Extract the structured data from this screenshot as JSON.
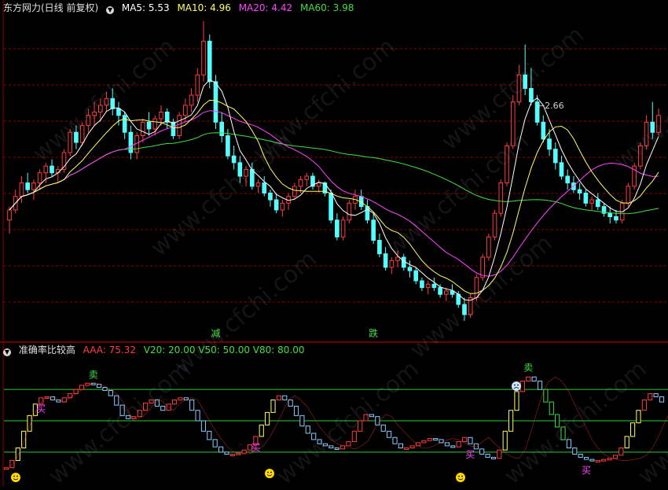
{
  "header": {
    "title": "东方网力(日线 前复权)",
    "ma": [
      {
        "label": "MA5: 5.53",
        "color": "#ffffff"
      },
      {
        "label": "MA10: 4.96",
        "color": "#ffff66"
      },
      {
        "label": "MA20: 4.42",
        "color": "#ff44ff"
      },
      {
        "label": "MA60: 3.98",
        "color": "#44dd44"
      }
    ]
  },
  "subheader": {
    "title": "准确率比较高",
    "aaa": "AAA: 75.32",
    "v": "V20: 20.00  V50: 50.00  V80: 80.00"
  },
  "watermark": "www.cfchi.com",
  "colors": {
    "up": "#ff3c3c",
    "down": "#54ffff",
    "ma5": "#ffffff",
    "ma10": "#ffff66",
    "ma20": "#ff44ff",
    "ma60": "#44dd44",
    "grid": "#8b0000",
    "level": "#2ecc40",
    "buy": "#ff44ff",
    "sell": "#44dd44"
  },
  "chart_data": [
    {
      "type": "candlestick",
      "title": "东方网力(日线 前复权)",
      "ylim": [
        2.4,
        7.2
      ],
      "annotations": [
        {
          "text": "2.66",
          "index": 86
        },
        {
          "text": "减",
          "index": 34
        },
        {
          "text": "跌",
          "index": 60
        }
      ],
      "ohlc": [
        [
          4.15,
          4.35,
          3.95,
          4.3
        ],
        [
          4.3,
          4.6,
          4.25,
          4.5
        ],
        [
          4.5,
          4.8,
          4.4,
          4.7
        ],
        [
          4.7,
          4.85,
          4.55,
          4.6
        ],
        [
          4.6,
          4.75,
          4.45,
          4.7
        ],
        [
          4.7,
          4.9,
          4.6,
          4.85
        ],
        [
          4.85,
          5.0,
          4.7,
          4.95
        ],
        [
          4.95,
          5.05,
          4.8,
          4.85
        ],
        [
          4.85,
          4.95,
          4.7,
          4.9
        ],
        [
          4.9,
          5.2,
          4.85,
          5.15
        ],
        [
          5.15,
          5.5,
          5.1,
          5.45
        ],
        [
          5.45,
          5.55,
          5.2,
          5.3
        ],
        [
          5.3,
          5.6,
          5.25,
          5.55
        ],
        [
          5.55,
          5.8,
          5.45,
          5.7
        ],
        [
          5.7,
          5.9,
          5.55,
          5.75
        ],
        [
          5.75,
          5.95,
          5.6,
          5.85
        ],
        [
          5.85,
          6.05,
          5.75,
          5.95
        ],
        [
          5.95,
          6.1,
          5.7,
          5.8
        ],
        [
          5.8,
          5.9,
          5.55,
          5.7
        ],
        [
          5.7,
          5.75,
          5.35,
          5.45
        ],
        [
          5.45,
          5.55,
          5.05,
          5.15
        ],
        [
          5.15,
          5.45,
          5.05,
          5.4
        ],
        [
          5.4,
          5.65,
          5.3,
          5.6
        ],
        [
          5.6,
          5.75,
          5.4,
          5.5
        ],
        [
          5.5,
          5.7,
          5.4,
          5.65
        ],
        [
          5.65,
          5.85,
          5.55,
          5.75
        ],
        [
          5.75,
          5.8,
          5.5,
          5.6
        ],
        [
          5.6,
          5.65,
          5.35,
          5.4
        ],
        [
          5.4,
          5.75,
          5.35,
          5.7
        ],
        [
          5.7,
          5.95,
          5.6,
          5.85
        ],
        [
          5.85,
          6.1,
          5.75,
          6.0
        ],
        [
          6.0,
          6.4,
          5.9,
          6.3
        ],
        [
          6.3,
          7.1,
          6.2,
          6.8
        ],
        [
          6.8,
          6.9,
          6.1,
          6.2
        ],
        [
          6.2,
          6.3,
          5.5,
          5.6
        ],
        [
          5.6,
          5.75,
          5.3,
          5.4
        ],
        [
          5.4,
          5.5,
          5.05,
          5.1
        ],
        [
          5.1,
          5.25,
          4.9,
          5.0
        ],
        [
          5.0,
          5.1,
          4.7,
          4.8
        ],
        [
          4.8,
          4.95,
          4.65,
          4.9
        ],
        [
          4.9,
          5.0,
          4.6,
          4.65
        ],
        [
          4.65,
          4.75,
          4.55,
          4.7
        ],
        [
          4.7,
          4.8,
          4.5,
          4.55
        ],
        [
          4.55,
          4.6,
          4.35,
          4.45
        ],
        [
          4.45,
          4.55,
          4.25,
          4.3
        ],
        [
          4.3,
          4.45,
          4.2,
          4.4
        ],
        [
          4.4,
          4.55,
          4.3,
          4.5
        ],
        [
          4.5,
          4.7,
          4.45,
          4.65
        ],
        [
          4.65,
          4.8,
          4.55,
          4.75
        ],
        [
          4.75,
          4.85,
          4.65,
          4.8
        ],
        [
          4.8,
          4.85,
          4.6,
          4.65
        ],
        [
          4.65,
          4.75,
          4.55,
          4.7
        ],
        [
          4.7,
          4.72,
          4.5,
          4.55
        ],
        [
          4.55,
          4.6,
          4.1,
          4.15
        ],
        [
          4.15,
          4.25,
          3.85,
          3.9
        ],
        [
          3.9,
          4.2,
          3.85,
          4.15
        ],
        [
          4.15,
          4.45,
          4.1,
          4.4
        ],
        [
          4.4,
          4.6,
          4.3,
          4.5
        ],
        [
          4.5,
          4.6,
          4.3,
          4.35
        ],
        [
          4.35,
          4.45,
          4.1,
          4.15
        ],
        [
          4.15,
          4.25,
          3.8,
          3.85
        ],
        [
          3.85,
          3.95,
          3.6,
          3.65
        ],
        [
          3.65,
          3.75,
          3.4,
          3.45
        ],
        [
          3.45,
          3.6,
          3.35,
          3.55
        ],
        [
          3.55,
          3.7,
          3.45,
          3.6
        ],
        [
          3.6,
          3.65,
          3.4,
          3.45
        ],
        [
          3.45,
          3.55,
          3.3,
          3.4
        ],
        [
          3.4,
          3.45,
          3.2,
          3.25
        ],
        [
          3.25,
          3.3,
          3.1,
          3.15
        ],
        [
          3.15,
          3.25,
          3.05,
          3.2
        ],
        [
          3.2,
          3.3,
          3.1,
          3.15
        ],
        [
          3.15,
          3.2,
          3.0,
          3.05
        ],
        [
          3.05,
          3.15,
          2.95,
          3.1
        ],
        [
          3.1,
          3.2,
          3.0,
          3.05
        ],
        [
          3.05,
          3.1,
          2.85,
          2.9
        ],
        [
          2.9,
          3.0,
          2.66,
          2.75
        ],
        [
          2.75,
          3.05,
          2.7,
          3.0
        ],
        [
          3.0,
          3.35,
          2.95,
          3.3
        ],
        [
          3.3,
          3.65,
          3.25,
          3.6
        ],
        [
          3.6,
          3.95,
          3.55,
          3.9
        ],
        [
          3.9,
          4.3,
          3.85,
          4.25
        ],
        [
          4.25,
          4.75,
          4.2,
          4.7
        ],
        [
          4.7,
          5.3,
          4.65,
          5.25
        ],
        [
          5.25,
          6.0,
          5.2,
          5.9
        ],
        [
          5.9,
          6.45,
          5.85,
          6.3
        ],
        [
          6.3,
          6.75,
          6.0,
          6.1
        ],
        [
          6.1,
          6.4,
          5.85,
          5.9
        ],
        [
          5.9,
          6.0,
          5.55,
          5.6
        ],
        [
          5.6,
          5.7,
          5.3,
          5.35
        ],
        [
          5.35,
          5.5,
          5.1,
          5.2
        ],
        [
          5.2,
          5.3,
          4.9,
          5.0
        ],
        [
          5.0,
          5.1,
          4.75,
          4.8
        ],
        [
          4.8,
          4.9,
          4.6,
          4.7
        ],
        [
          4.7,
          4.8,
          4.55,
          4.6
        ],
        [
          4.6,
          4.7,
          4.45,
          4.55
        ],
        [
          4.55,
          4.6,
          4.35,
          4.4
        ],
        [
          4.4,
          4.5,
          4.3,
          4.45
        ],
        [
          4.45,
          4.55,
          4.3,
          4.35
        ],
        [
          4.35,
          4.4,
          4.2,
          4.25
        ],
        [
          4.25,
          4.35,
          4.1,
          4.2
        ],
        [
          4.2,
          4.3,
          4.1,
          4.15
        ],
        [
          4.15,
          4.45,
          4.1,
          4.4
        ],
        [
          4.4,
          4.7,
          4.35,
          4.65
        ],
        [
          4.65,
          5.0,
          4.6,
          4.95
        ],
        [
          4.95,
          5.3,
          4.9,
          5.25
        ],
        [
          5.25,
          5.7,
          5.2,
          5.6
        ],
        [
          5.6,
          5.9,
          5.35,
          5.45
        ],
        [
          5.45,
          5.8,
          5.4,
          5.7
        ]
      ]
    },
    {
      "type": "line",
      "title": "准确率比较高",
      "ylim": [
        -5,
        105
      ],
      "levels": [
        20,
        50,
        80
      ],
      "series": [
        {
          "name": "AAA",
          "values": [
            5,
            12,
            24,
            40,
            55,
            66,
            72,
            73,
            70,
            68,
            72,
            76,
            80,
            84,
            86,
            85,
            82,
            79,
            74,
            65,
            55,
            52,
            54,
            60,
            67,
            70,
            64,
            60,
            66,
            70,
            72,
            70,
            60,
            50,
            40,
            32,
            25,
            20,
            18,
            18,
            19,
            22,
            27,
            35,
            46,
            58,
            70,
            74,
            70,
            64,
            55,
            45,
            38,
            32,
            28,
            26,
            24,
            23,
            26,
            30,
            40,
            50,
            56,
            54,
            46,
            40,
            34,
            28,
            24,
            24,
            26,
            29,
            31,
            33,
            32,
            29,
            26,
            25,
            30,
            34,
            28,
            23,
            18,
            15,
            14,
            22,
            40,
            60,
            78,
            88,
            92,
            88,
            80,
            68,
            56,
            44,
            32,
            24,
            18,
            15,
            13,
            12,
            12,
            13,
            14,
            17,
            24,
            35,
            48,
            60,
            70,
            76,
            73,
            68
          ]
        },
        {
          "name": "V20",
          "values": [
            20
          ]
        },
        {
          "name": "V50",
          "values": [
            50
          ]
        },
        {
          "name": "V80",
          "values": [
            80
          ]
        }
      ],
      "markers": [
        {
          "text": "卖",
          "index": 15
        },
        {
          "text": "买",
          "index": 6
        },
        {
          "text": "买",
          "index": 43
        },
        {
          "text": "卖",
          "index": 90
        },
        {
          "text": "买",
          "index": 80
        },
        {
          "text": "买",
          "index": 100
        }
      ]
    }
  ]
}
